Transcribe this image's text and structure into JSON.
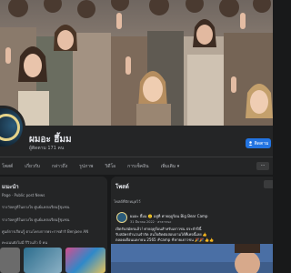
{
  "profile": {
    "name": "ผมอะ ฮึ้มม",
    "followers": "ผู้ติดตาม 171 คน",
    "follow_label": "ติดตาม"
  },
  "tabs": [
    "โพสต์",
    "เกี่ยวกับ",
    "กล่าวถึง",
    "รูปภาพ",
    "วิดีโอ",
    "การเช็คอิน",
    "เพิ่มเติม ▾"
  ],
  "intro": {
    "title": "แนะนำ",
    "lines": [
      "Page · Public post News",
      "รางวัลครูดีในดวงใจ ศูนย์แหล่งเรียนรู้ชุมชน",
      "รางวัลครูดีในดวงใจ ศูนย์แหล่งเรียนรู้ชุมชน",
      "ศูนย์การเรียนรู้ ตามโครงการพระราชดำริ Benjaev AN",
      "คะแนนยังไม่มี รีวิวแล้ว 0 คน"
    ]
  },
  "posts": {
    "title": "โพสต์",
    "pinned_label": "โพสต์ที่ปักหมุดไว้",
    "author": "ผมอะ ฮึ้มม 🙂 อยู่ที่ ค่ายฤดูร้อน Big Bear Camp",
    "time": "31 มีนาคม 2022 · สาธารณะ",
    "text_lines": [
      "เปิดรับสมัครแล้ว! ค่ายฤดูร้อนสำหรับเยาวชน ประจำปีนี้",
      "รับสมัครจำนวนจำกัด สนใจติดต่อสอบถามได้ที่เพจนี้เลย 👍",
      "ตลอดเดือนเมษายน 2565 #camp #ค่ายเยาวชน 🎉🎉 👍👍"
    ]
  },
  "icons": {
    "follow": "follow-icon",
    "filter": "filter-icon"
  },
  "colors": {
    "accent": "#2374e1",
    "background": "#18191a",
    "card": "#242526"
  }
}
